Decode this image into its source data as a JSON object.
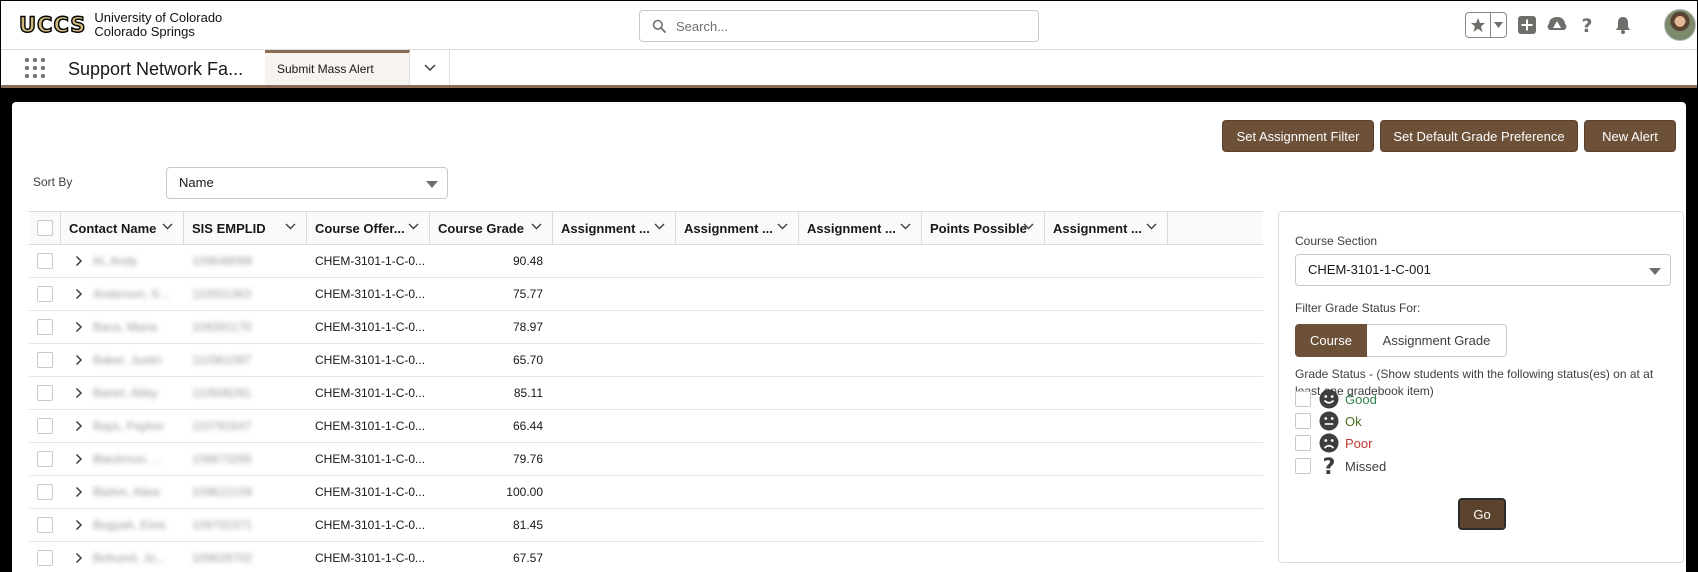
{
  "header": {
    "logo_mark": "UCCS",
    "logo_line1": "University of Colorado",
    "logo_line2": "Colorado Springs",
    "search_placeholder": "Search..."
  },
  "icons": {
    "search": "search-icon",
    "favorites": "star-icon",
    "favorites_menu": "chevron-down-icon",
    "add": "plus-icon",
    "setup": "trailhead-icon",
    "help": "question-icon",
    "notifications": "bell-icon",
    "app_launcher": "grid-dots-icon"
  },
  "nav": {
    "app_name": "Support Network Fa...",
    "tab_label": "Submit Mass Alert"
  },
  "toolbar": {
    "set_assignment_filter": "Set Assignment Filter",
    "set_default_grade_preference": "Set Default Grade Preference",
    "new_alert": "New Alert"
  },
  "sort": {
    "label": "Sort By",
    "value": "Name"
  },
  "table": {
    "columns": [
      "Contact Name",
      "SIS EMPLID",
      "Course Offer...",
      "Course Grade",
      "Assignment ...",
      "Assignment ...",
      "Assignment ...",
      "Points Possible",
      "Assignment ..."
    ],
    "rows": [
      {
        "name": "Al, Andy",
        "emplid": "109648099",
        "course": "CHEM-3101-1-C-0...",
        "grade": "90.48"
      },
      {
        "name": "Anderson, S...",
        "emplid": "110001363",
        "course": "CHEM-3101-1-C-0...",
        "grade": "75.77"
      },
      {
        "name": "Baca, Maria",
        "emplid": "109391170",
        "course": "CHEM-3101-1-C-0...",
        "grade": "78.97"
      },
      {
        "name": "Baker, Justin",
        "emplid": "110361087",
        "course": "CHEM-3101-1-C-0...",
        "grade": "65.70"
      },
      {
        "name": "Bartel, Abby",
        "emplid": "110508291",
        "course": "CHEM-3101-1-C-0...",
        "grade": "85.11"
      },
      {
        "name": "Bays, Payton",
        "emplid": "110791647",
        "course": "CHEM-3101-1-C-0...",
        "grade": "66.44"
      },
      {
        "name": "Blackmon, ...",
        "emplid": "108873285",
        "course": "CHEM-3101-1-C-0...",
        "grade": "79.76"
      },
      {
        "name": "Blahm, Aliea",
        "emplid": "109622109",
        "course": "CHEM-3101-1-C-0...",
        "grade": "100.00"
      },
      {
        "name": "Bogyah, Elvis",
        "emplid": "109702371",
        "course": "CHEM-3101-1-C-0...",
        "grade": "81.45"
      },
      {
        "name": "Bohumil, Jo...",
        "emplid": "109628702",
        "course": "CHEM-3101-1-C-0...",
        "grade": "67.57"
      }
    ]
  },
  "filter_panel": {
    "course_section_label": "Course Section",
    "course_section_value": "CHEM-3101-1-C-001",
    "filter_for_label": "Filter Grade Status For:",
    "toggle_course": "Course",
    "toggle_assignment": "Assignment Grade",
    "grade_status_desc": "Grade Status - (Show students with the following status(es) on at at least one gradebook item)",
    "statuses": [
      {
        "label": "Good",
        "color": "#2e844a",
        "icon": "smile-face-icon"
      },
      {
        "label": "Ok",
        "color": "#4a6b1e",
        "icon": "neutral-face-icon"
      },
      {
        "label": "Poor",
        "color": "#c23934",
        "icon": "frown-face-icon"
      },
      {
        "label": "Missed",
        "color": "#3e3e3c",
        "icon": "question-mark-icon"
      }
    ],
    "go_label": "Go"
  },
  "colors": {
    "brand_brown": "#6c5037",
    "tab_accent": "#8b6d55"
  }
}
